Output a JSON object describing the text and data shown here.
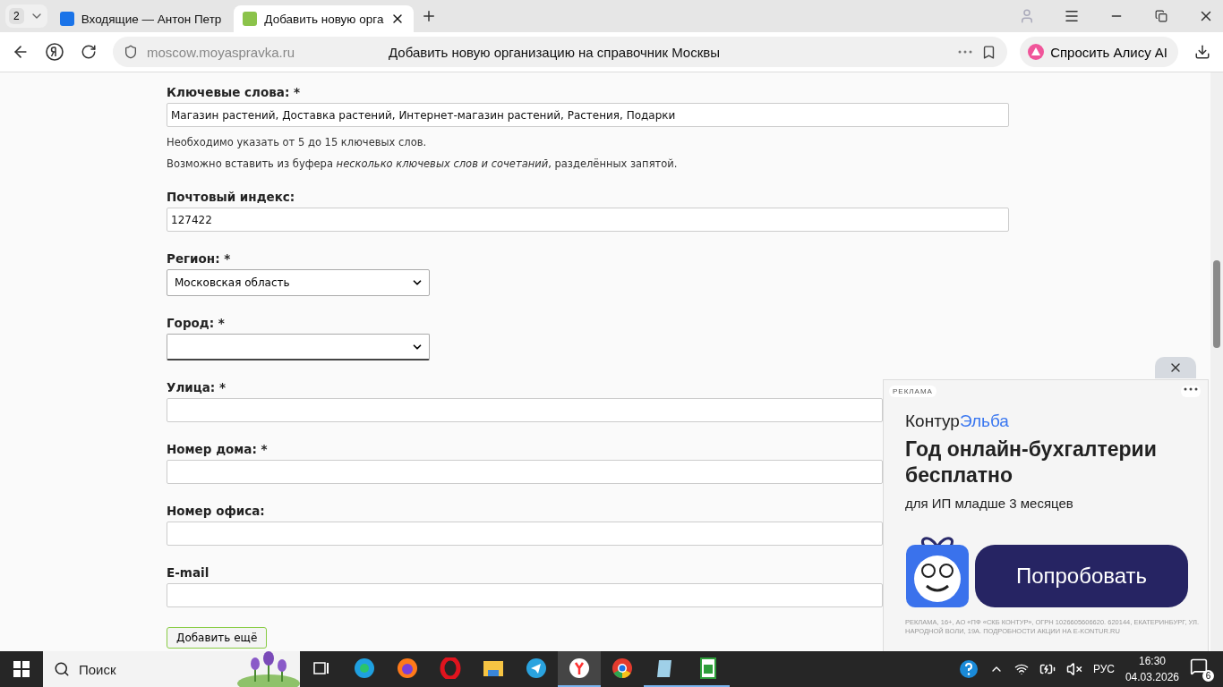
{
  "browser": {
    "tab_count": "2",
    "tabs": [
      {
        "kind": "mail",
        "title": "Входящие — Антон Петр",
        "selected": false
      },
      {
        "kind": "page",
        "title": "Добавить новую орга",
        "selected": true
      }
    ],
    "url": "moscow.moyaspravka.ru",
    "page_title": "Добавить новую организацию на справочник Москвы",
    "alice_button": "Спросить Алису AI"
  },
  "form": {
    "fields": [
      {
        "kind": "text",
        "label": "Ключевые слова: *",
        "value": "Магазин растений, Доставка растений, Интернет-магазин растений, Растения, Подарки",
        "hints": [
          "Необходимо указать от 5 до 15 ключевых слов.",
          "Возможно вставить из буфера *несколько ключевых слов и сочетаний*, разделённых запятой."
        ]
      },
      {
        "kind": "text",
        "label": "Почтовый индекс:",
        "value": "127422"
      },
      {
        "kind": "select",
        "label": "Регион: *",
        "value": "Московская область",
        "focused": false
      },
      {
        "kind": "select",
        "label": "Город: *",
        "focused": true
      },
      {
        "kind": "text",
        "label": "Улица: *"
      },
      {
        "kind": "text",
        "label": "Номер дома: *"
      },
      {
        "kind": "text",
        "label": "Номер офиса:"
      },
      {
        "kind": "text",
        "label": "E-mail"
      }
    ],
    "submit": "Добавить ещё"
  },
  "ad": {
    "tag": "РЕКЛАМА",
    "brand": "Контур",
    "brand_accent": "Эльба",
    "headline": "Год онлайн-бухгалтерии бесплатно",
    "subline": "для ИП младше 3 месяцев",
    "cta": "Попробовать",
    "legal": "РЕКЛАМА, 16+, АО «ПФ «СКБ КОНТУР», ОГРН 1026605606620. 620144, ЕКАТЕРИНБУРГ, УЛ. НАРОДНОЙ ВОЛИ, 19А. ПОДРОБНОСТИ АКЦИИ НА E-KONTUR.RU"
  },
  "taskbar": {
    "search_placeholder": "Поиск",
    "apps": [
      {
        "kind": "taskview",
        "selected": false,
        "running": false
      },
      {
        "kind": "edge",
        "selected": false,
        "running": false
      },
      {
        "kind": "firefox",
        "selected": false,
        "running": false
      },
      {
        "kind": "opera",
        "selected": false,
        "running": false
      },
      {
        "kind": "folder",
        "selected": false,
        "running": false
      },
      {
        "kind": "telegram",
        "selected": false,
        "running": false
      },
      {
        "kind": "yandex",
        "selected": true,
        "running": true
      },
      {
        "kind": "chrome",
        "selected": false,
        "running": false
      },
      {
        "kind": "notepad",
        "selected": false,
        "running": true
      },
      {
        "kind": "sheet",
        "selected": false,
        "running": true
      }
    ],
    "language": "РУС",
    "time": "16:30",
    "date": "04.03.2026",
    "notifications": "6"
  }
}
